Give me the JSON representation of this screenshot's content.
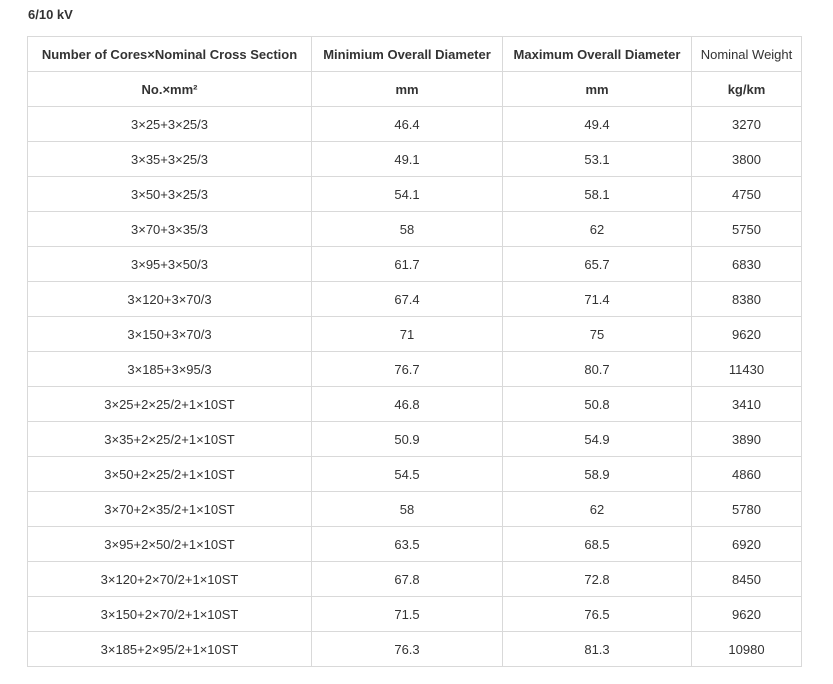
{
  "heading": "6/10 kV",
  "table": {
    "headers": [
      "Number of Cores×Nominal Cross Section",
      "Minimium Overall Diameter",
      "Maximum Overall Diameter",
      "Nominal Weight"
    ],
    "units": [
      "No.×mm²",
      "mm",
      "mm",
      "kg/km"
    ],
    "rows": [
      [
        "3×25+3×25/3",
        "46.4",
        "49.4",
        "3270"
      ],
      [
        "3×35+3×25/3",
        "49.1",
        "53.1",
        "3800"
      ],
      [
        "3×50+3×25/3",
        "54.1",
        "58.1",
        "4750"
      ],
      [
        "3×70+3×35/3",
        "58",
        "62",
        "5750"
      ],
      [
        "3×95+3×50/3",
        "61.7",
        "65.7",
        "6830"
      ],
      [
        "3×120+3×70/3",
        "67.4",
        "71.4",
        "8380"
      ],
      [
        "3×150+3×70/3",
        "71",
        "75",
        "9620"
      ],
      [
        "3×185+3×95/3",
        "76.7",
        "80.7",
        "11430"
      ],
      [
        "3×25+2×25/2+1×10ST",
        "46.8",
        "50.8",
        "3410"
      ],
      [
        "3×35+2×25/2+1×10ST",
        "50.9",
        "54.9",
        "3890"
      ],
      [
        "3×50+2×25/2+1×10ST",
        "54.5",
        "58.9",
        "4860"
      ],
      [
        "3×70+2×35/2+1×10ST",
        "58",
        "62",
        "5780"
      ],
      [
        "3×95+2×50/2+1×10ST",
        "63.5",
        "68.5",
        "6920"
      ],
      [
        "3×120+2×70/2+1×10ST",
        "67.8",
        "72.8",
        "8450"
      ],
      [
        "3×150+2×70/2+1×10ST",
        "71.5",
        "76.5",
        "9620"
      ],
      [
        "3×185+2×95/2+1×10ST",
        "76.3",
        "81.3",
        "10980"
      ]
    ]
  }
}
